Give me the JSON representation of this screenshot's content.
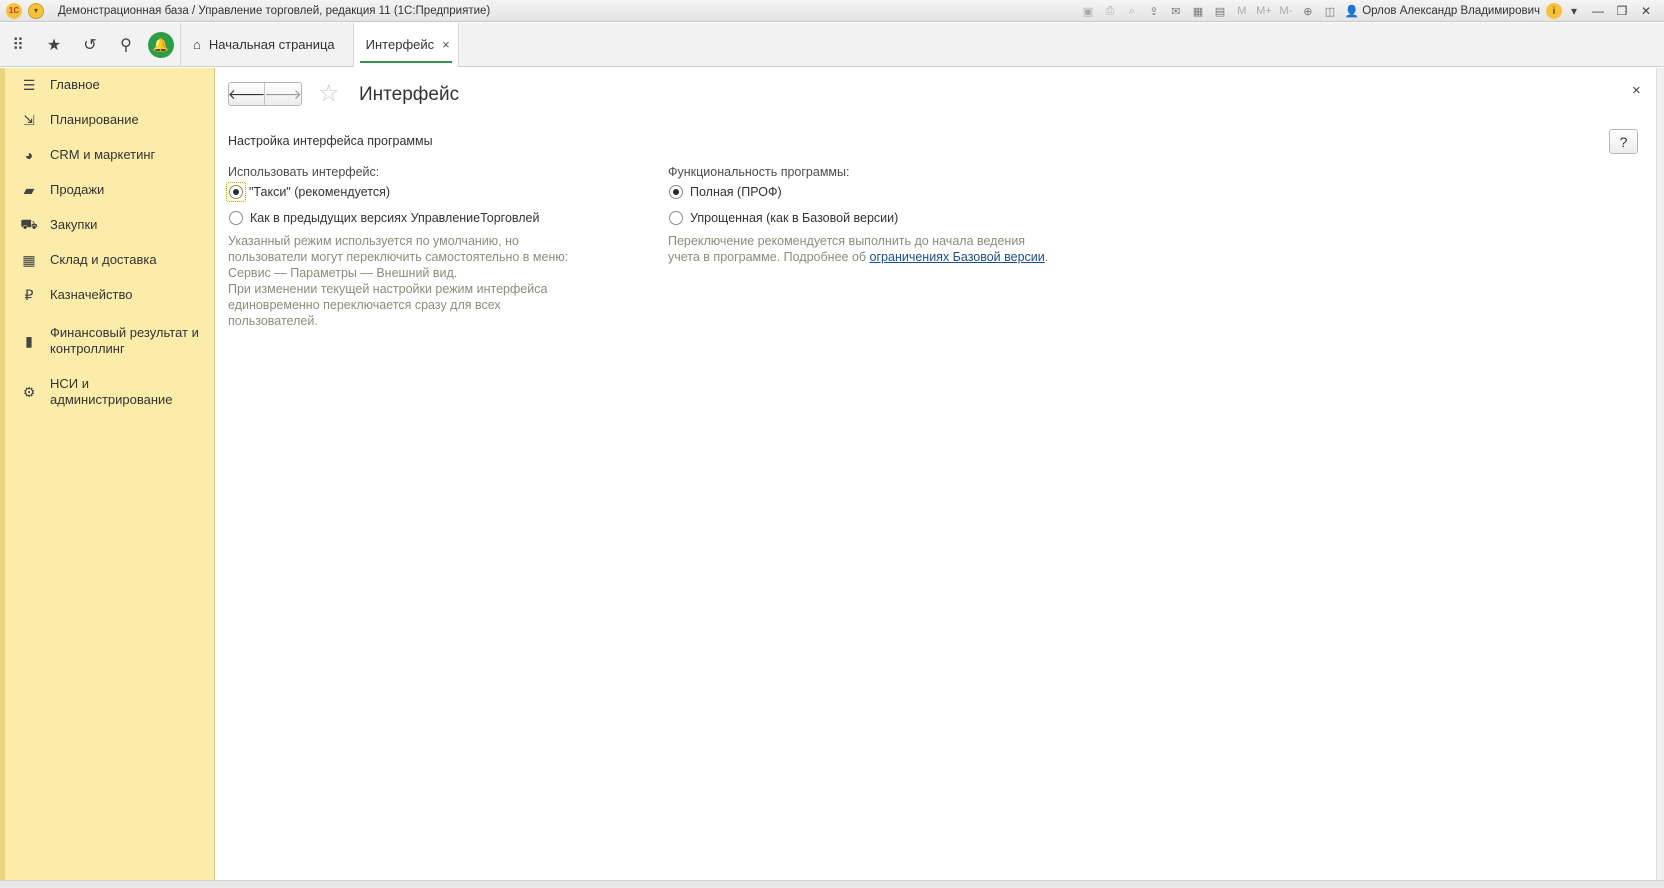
{
  "titlebar": {
    "logo": "1C",
    "title": "Демонстрационная база / Управление торговлей, редакция 11  (1С:Предприятие)",
    "memory_buttons": [
      "M",
      "M+",
      "M-"
    ],
    "user": "Орлов Александр Владимирович",
    "info": "i"
  },
  "navbar": {
    "tabs": [
      {
        "label": "Начальная страница"
      },
      {
        "label": "Интерфейс",
        "close": "×"
      }
    ]
  },
  "sidebar": {
    "items": [
      {
        "label": "Главное",
        "icon": "menu-lines-icon"
      },
      {
        "label": "Планирование",
        "icon": "planning-icon"
      },
      {
        "label": "CRM и маркетинг",
        "icon": "pie-chart-icon"
      },
      {
        "label": "Продажи",
        "icon": "bag-icon"
      },
      {
        "label": "Закупки",
        "icon": "cart-icon"
      },
      {
        "label": "Склад и доставка",
        "icon": "warehouse-icon"
      },
      {
        "label": "Казначейство",
        "icon": "ruble-coin-icon"
      },
      {
        "label": "Финансовый результат и контроллинг",
        "icon": "bar-chart-icon"
      },
      {
        "label": "НСИ и администрирование",
        "icon": "gear-icon"
      }
    ]
  },
  "form": {
    "title": "Интерфейс",
    "help": "?",
    "close": "×",
    "section_title": "Настройка интерфейса программы",
    "interface": {
      "label": "Использовать интерфейс:",
      "options": [
        "\"Такси\" (рекомендуется)",
        "Как в предыдущих версиях УправлениеТорговлей"
      ],
      "selected": 0,
      "hint_lines": [
        "Указанный режим используется по умолчанию, но",
        "пользователи могут переключить самостоятельно в меню:",
        "Сервис — Параметры — Внешний вид.",
        "При изменении текущей настройки режим интерфейса",
        "единовременно переключается сразу для всех",
        "пользователей."
      ]
    },
    "functionality": {
      "label": "Функциональность программы:",
      "options": [
        "Полная (ПРОФ)",
        "Упрощенная (как в Базовой версии)"
      ],
      "selected": 0,
      "hint_line1": "Переключение рекомендуется выполнить до начала ведения",
      "hint_line2_prefix": "учета в программе. Подробнее об ",
      "hint_link": "ограничениях Базовой версии",
      "hint_line2_suffix": "."
    }
  },
  "colors": {
    "sidebar_bg": "#fcecaa",
    "accent_green": "#2e9b47",
    "link": "#1a4f8a",
    "hint_text": "#8c8c7c"
  }
}
